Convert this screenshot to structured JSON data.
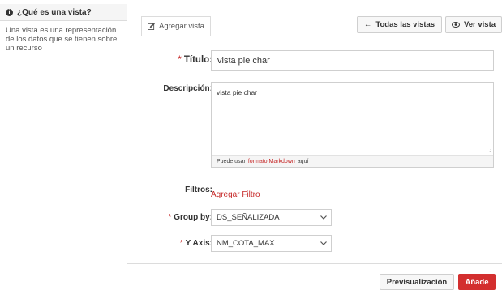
{
  "sidebar": {
    "title": "¿Qué es una vista?",
    "description": "Una vista es una representación de los datos que se tienen sobre un recurso"
  },
  "tabs": {
    "active_label": "Agregar vista"
  },
  "toolbar": {
    "all_views_label": "Todas las vistas",
    "view_label": "Ver vista"
  },
  "form": {
    "title_label": "Título:",
    "title_value": "vista pie char",
    "description_label": "Descripción:",
    "description_value": "vista pie char",
    "markdown_hint_prefix": "Puede usar",
    "markdown_hint_link": "formato Markdown",
    "markdown_hint_suffix": "aquí",
    "filters_label": "Filtros:",
    "add_filter_label": "Agregar Filtro",
    "group_by_label": "Group by:",
    "group_by_value": "DS_SEÑALIZADA",
    "y_axis_label": "Y Axis:",
    "y_axis_value": "NM_COTA_MAX",
    "required_marker": "*"
  },
  "actions": {
    "preview_label": "Previsualización",
    "add_label": "Añade"
  },
  "colors": {
    "accent": "#d32f2f"
  },
  "icons": {
    "info": "info-icon",
    "edit": "edit-icon",
    "back": "arrow-left-icon",
    "eye": "eye-icon",
    "dropdown": "chevron-down-icon"
  }
}
